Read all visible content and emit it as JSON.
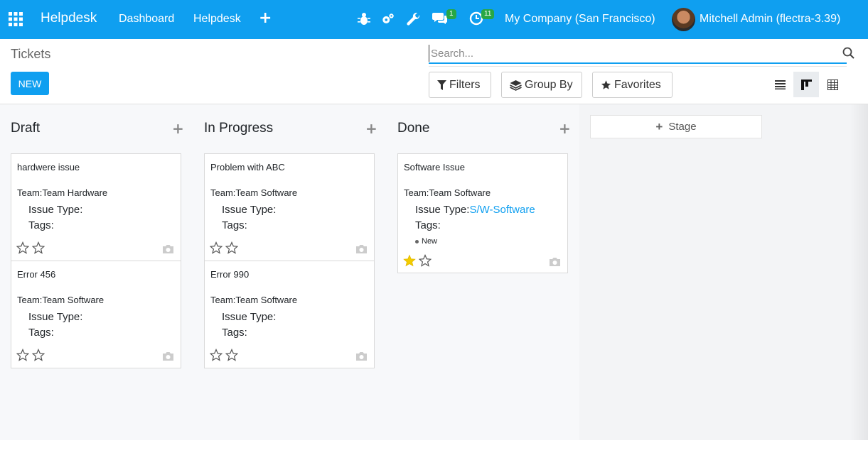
{
  "navbar": {
    "brand": "Helpdesk",
    "menu": [
      "Dashboard",
      "Helpdesk"
    ],
    "plus": "+",
    "chat_badge": "1",
    "activity_badge": "11",
    "company": "My Company (San Francisco)",
    "user": "Mitchell Admin (flectra-3.39)",
    "color": "#0f9ff0"
  },
  "control": {
    "title": "Tickets",
    "new_label": "NEW",
    "search_placeholder": "Search...",
    "filters": "Filters",
    "group_by": "Group By",
    "favorites": "Favorites"
  },
  "kanban": {
    "columns": [
      {
        "title": "Draft",
        "cards": [
          {
            "name": "hardwere issue",
            "team": "Team:Team Hardware",
            "issue_label": "Issue Type:",
            "issue_value": "",
            "tags_label": "Tags:",
            "tag": "",
            "starred": false
          },
          {
            "name": "Error 456",
            "team": "Team:Team Software",
            "issue_label": "Issue Type:",
            "issue_value": "",
            "tags_label": "Tags:",
            "tag": "",
            "starred": false
          }
        ]
      },
      {
        "title": "In Progress",
        "cards": [
          {
            "name": "Problem with ABC",
            "team": "Team:Team Software",
            "issue_label": "Issue Type:",
            "issue_value": "",
            "tags_label": "Tags:",
            "tag": "",
            "starred": false
          },
          {
            "name": "Error 990",
            "team": "Team:Team Software",
            "issue_label": "Issue Type:",
            "issue_value": "",
            "tags_label": "Tags:",
            "tag": "",
            "starred": false
          }
        ]
      },
      {
        "title": "Done",
        "cards": [
          {
            "name": "Software Issue",
            "team": "Team:Team Software",
            "issue_label": "Issue Type:",
            "issue_value": "S/W-Software",
            "tags_label": "Tags:",
            "tag": "New",
            "starred": true
          }
        ]
      }
    ],
    "add_stage": "Stage"
  }
}
